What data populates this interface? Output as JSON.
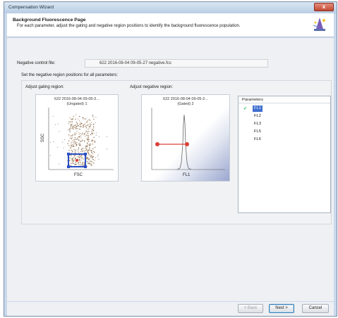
{
  "window": {
    "title": "Compensation Wizard",
    "close_label": "x"
  },
  "header": {
    "title": "Background Fluorescence Page",
    "description": "For each parameter, adjust the gating and negative region positions to identify the background fluorescence population."
  },
  "negative_control": {
    "label": "Negative control file:",
    "value": "622 2016-08-04 09-05-27 negative.fcs"
  },
  "group_label": "Set the negative region positions for all parameters:",
  "gating": {
    "label": "Adjust gating region:",
    "plot_title": "622 2016-08-04 09-05-2...",
    "plot_subtitle": "(Ungated) 1",
    "x_axis": "FSC",
    "y_axis": "SSC"
  },
  "negative_region": {
    "label": "Adjust negative region:",
    "plot_title": "622 2016-08-04 09-05-2...",
    "plot_subtitle": "(Gated) 2",
    "x_axis": "FL1"
  },
  "parameters": {
    "header": "Parameters",
    "items": [
      "FL1",
      "FL2",
      "FL3",
      "FL5",
      "FL6"
    ],
    "selected": "FL1"
  },
  "buttons": {
    "back": "< Back",
    "next": "Next >",
    "cancel": "Cancel"
  },
  "colors": {
    "gate": "#2b4fc4",
    "region": "#d9413a",
    "selection": "#3f6fd0"
  },
  "icons": {
    "wizard": "wizard-hat-icon",
    "check": "check-icon"
  }
}
